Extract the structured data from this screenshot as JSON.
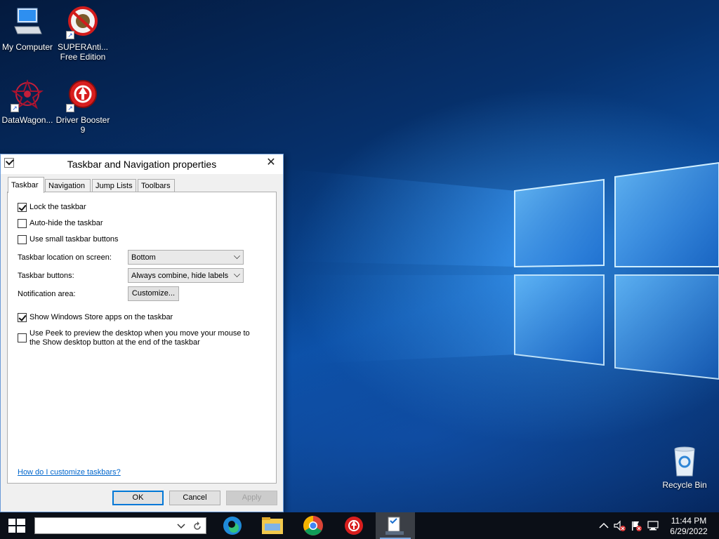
{
  "desktop": {
    "icons": [
      {
        "label": "My Computer",
        "icon": "computer-icon"
      },
      {
        "label": "SUPERAnti... Free Edition",
        "icon": "superantispyware-icon"
      },
      {
        "label": "DataWagon...",
        "icon": "datawagon-icon"
      },
      {
        "label": "Driver Booster 9",
        "icon": "driver-booster-icon"
      },
      {
        "label": "Recycle Bin",
        "icon": "recycle-bin-icon"
      }
    ]
  },
  "dialog": {
    "title": "Taskbar and Navigation properties",
    "close_glyph": "✕",
    "tabs": [
      {
        "label": "Taskbar",
        "active": true
      },
      {
        "label": "Navigation",
        "active": false
      },
      {
        "label": "Jump Lists",
        "active": false
      },
      {
        "label": "Toolbars",
        "active": false
      }
    ],
    "options": {
      "lock_taskbar": {
        "label": "Lock the taskbar",
        "checked": true
      },
      "auto_hide": {
        "label": "Auto-hide the taskbar",
        "checked": false
      },
      "small_buttons": {
        "label": "Use small taskbar buttons",
        "checked": false
      },
      "store_apps": {
        "label": "Show Windows Store apps on the taskbar",
        "checked": true
      },
      "peek": {
        "label_line1": "Use Peek to preview the desktop when you move your mouse to",
        "label_line2": "the Show desktop button at the end of the taskbar",
        "checked": false
      }
    },
    "location": {
      "label": "Taskbar location on screen:",
      "value": "Bottom"
    },
    "buttons_combine": {
      "label": "Taskbar buttons:",
      "value": "Always combine, hide labels"
    },
    "notification": {
      "label": "Notification area:",
      "button": "Customize..."
    },
    "help_link": "How do I customize taskbars?",
    "ok": "OK",
    "cancel": "Cancel",
    "apply": "Apply"
  },
  "taskbar": {
    "search_placeholder": "",
    "apps": [
      "edge-icon",
      "file-explorer-icon",
      "chrome-icon",
      "driver-booster-icon",
      "taskbar-properties-icon"
    ],
    "clock_time": "11:44 PM",
    "clock_date": "6/29/2022"
  }
}
